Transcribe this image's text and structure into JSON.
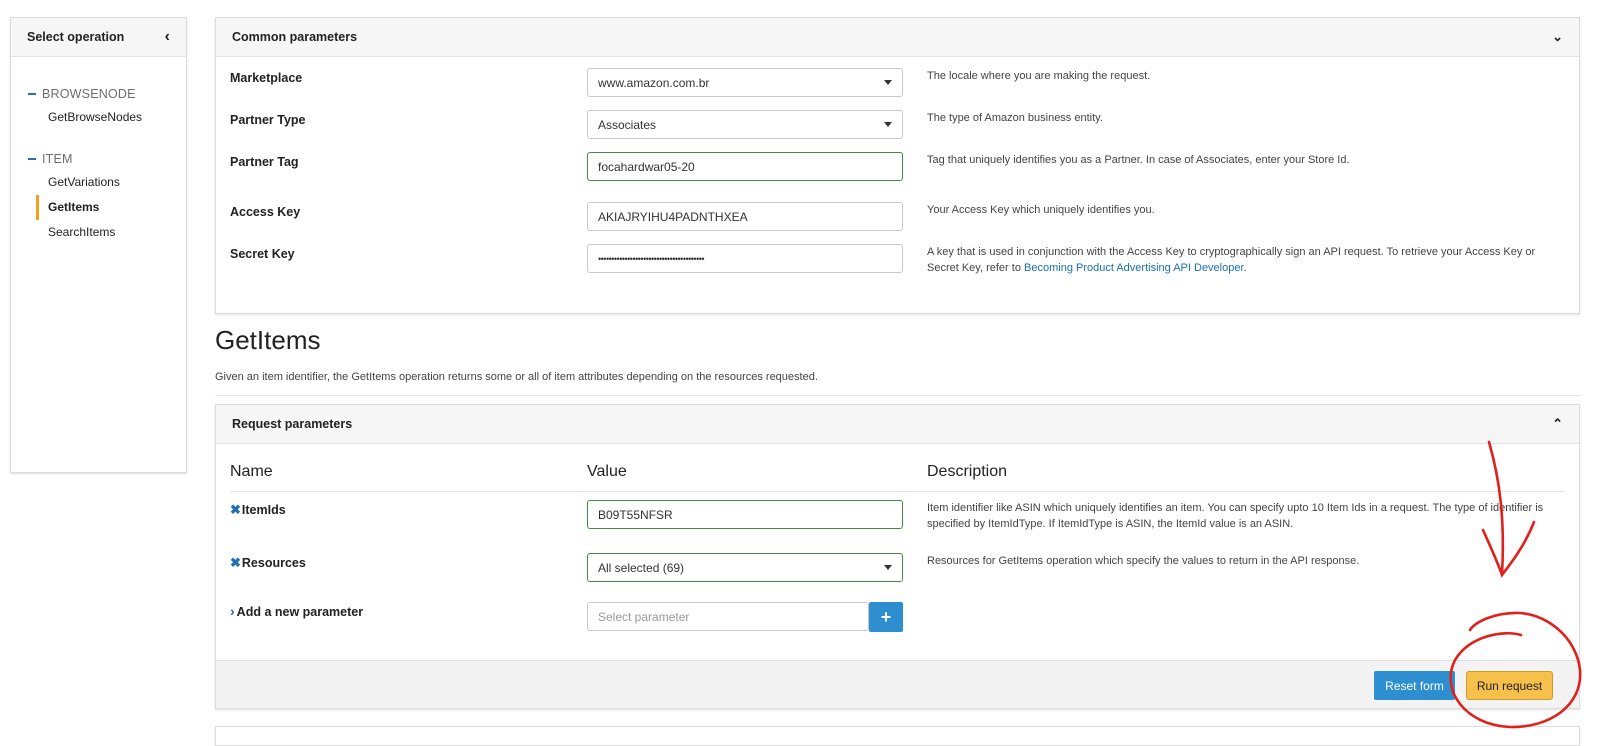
{
  "sidebar": {
    "title": "Select operation",
    "sections": [
      {
        "title": "BROWSENODE",
        "items": [
          "GetBrowseNodes"
        ]
      },
      {
        "title": "ITEM",
        "items": [
          "GetVariations",
          "GetItems",
          "SearchItems"
        ]
      }
    ],
    "active_item": "GetItems"
  },
  "common": {
    "title": "Common parameters",
    "marketplace": {
      "label": "Marketplace",
      "value": "www.amazon.com.br",
      "desc": "The locale where you are making the request."
    },
    "partner_type": {
      "label": "Partner Type",
      "value": "Associates",
      "desc": "The type of Amazon business entity."
    },
    "partner_tag": {
      "label": "Partner Tag",
      "value": "focahardwar05-20",
      "desc": "Tag that uniquely identifies you as a Partner. In case of Associates, enter your Store Id."
    },
    "access_key": {
      "label": "Access Key",
      "value": "AKIAJRYIHU4PADNTHXEA",
      "desc": "Your Access Key which uniquely identifies you."
    },
    "secret_key": {
      "label": "Secret Key",
      "value": "••••••••••••••••••••••••••••••••••••••••",
      "desc": "A key that is used in conjunction with the Access Key to cryptographically sign an API request. To retrieve your Access Key or Secret Key, refer to",
      "link": "Becoming Product Advertising API Developer",
      "after_link": "."
    }
  },
  "operation": {
    "title": "GetItems",
    "description": "Given an item identifier, the GetItems operation returns some or all of item attributes depending on the resources requested."
  },
  "request": {
    "title": "Request parameters",
    "col_name": "Name",
    "col_value": "Value",
    "col_desc": "Description",
    "item_ids": {
      "label": "ItemIds",
      "value": "B09T55NFSR",
      "desc": "Item identifier like ASIN which uniquely identifies an item. You can specify upto 10 Item Ids in a request. The type of identifier is specified by ItemIdType. If ItemIdType is ASIN, the ItemId value is an ASIN."
    },
    "resources": {
      "label": "Resources",
      "value": "All selected (69)",
      "desc": "Resources for GetItems operation which specify the values to return in the API response."
    },
    "add_param": {
      "label": "Add a new parameter",
      "placeholder": "Select parameter"
    },
    "reset_label": "Reset form",
    "run_label": "Run request"
  },
  "colors": {
    "accent": "#2e8fd0",
    "run_button": "#f7c04b",
    "active_indicator": "#f0a11d",
    "annotation": "#e0201b"
  }
}
